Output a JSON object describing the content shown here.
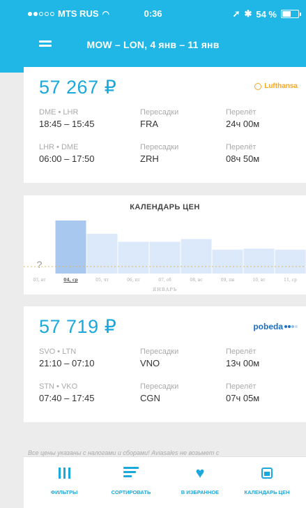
{
  "status": {
    "carrier": "MTS RUS",
    "time": "0:36",
    "battery": "54 %",
    "battery_level": 0.54
  },
  "header": {
    "title": "MOW – LON, 4 янв – 11 янв"
  },
  "tickets": [
    {
      "price": "57 267 ₽",
      "airline": "Lufthansa",
      "legs": [
        {
          "route": "DME • LHR",
          "times": "18:45 – 15:45",
          "stops_label": "Пересадки",
          "stops": "FRA",
          "duration_label": "Перелёт",
          "duration": "24ч 00м"
        },
        {
          "route": "LHR • DME",
          "times": "06:00 – 17:50",
          "stops_label": "Пересадки",
          "stops": "ZRH",
          "duration_label": "Перелёт",
          "duration": "08ч 50м"
        }
      ]
    },
    {
      "price": "57 719 ₽",
      "airline": "pobeda",
      "legs": [
        {
          "route": "SVO • LTN",
          "times": "21:10 – 07:10",
          "stops_label": "Пересадки",
          "stops": "VNO",
          "duration_label": "Перелёт",
          "duration": "13ч 00м"
        },
        {
          "route": "STN • VKO",
          "times": "07:40 – 17:45",
          "stops_label": "Пересадки",
          "stops": "CGN",
          "duration_label": "Перелёт",
          "duration": "07ч 05м"
        }
      ]
    }
  ],
  "calendar": {
    "title": "КАЛЕНДАРЬ ЦЕН",
    "month": "ЯНВАРЬ",
    "unknown_marker": "?",
    "selected_color": "#a9c8ef",
    "bar_color": "#dce9fb"
  },
  "chart_data": {
    "type": "bar",
    "title": "КАЛЕНДАРЬ ЦЕН",
    "xlabel": "ЯНВАРЬ",
    "categories": [
      "03, вт",
      "04, ср",
      "05, чт",
      "06, пт",
      "07, сб",
      "08, вс",
      "09, пн",
      "10, вт",
      "11, ср"
    ],
    "values": [
      null,
      1.0,
      0.75,
      0.6,
      0.6,
      0.65,
      0.45,
      0.47,
      0.45
    ],
    "selected": "04, ср",
    "value_scale": "relative"
  },
  "notice": "Все цены указаны с налогами и сборами! Aviasales не возьмет с",
  "tabs": [
    {
      "label": "ФИЛЬТРЫ",
      "icon": "filter-icon"
    },
    {
      "label": "СОРТИРОВАТЬ",
      "icon": "sort-icon"
    },
    {
      "label": "В ИЗБРАННОЕ",
      "icon": "heart-icon"
    },
    {
      "label": "КАЛЕНДАРЬ ЦЕН",
      "icon": "calendar-icon"
    }
  ],
  "colors": {
    "accent": "#1aa8dd",
    "header": "#20b7e6"
  }
}
